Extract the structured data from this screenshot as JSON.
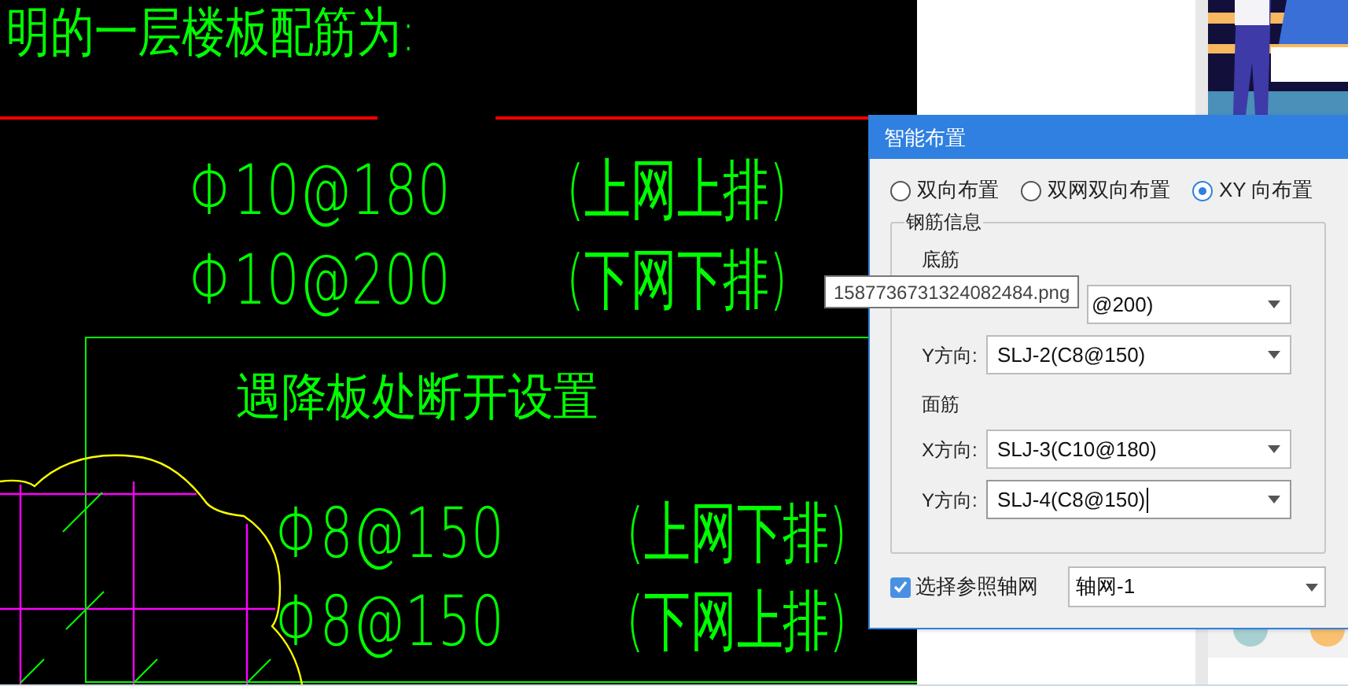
{
  "cad": {
    "heading": "明的一层楼板配筋为:",
    "top_rebar": [
      {
        "spec": "Φ10@180",
        "note": "(上网上排)"
      },
      {
        "spec": "Φ10@200",
        "note": "(下网下排)"
      }
    ],
    "note_title": "遇降板处断开设置",
    "bottom_rebar": [
      {
        "spec": "Φ8@150",
        "note": "(上网下排)"
      },
      {
        "spec": "Φ8@150",
        "note": "(下网上排)"
      }
    ]
  },
  "dialog": {
    "title": "智能布置",
    "modes": [
      {
        "label": "双向布置",
        "selected": false
      },
      {
        "label": "双网双向布置",
        "selected": false
      },
      {
        "label": "XY 向布置",
        "selected": true
      }
    ],
    "group": {
      "title": "钢筋信息",
      "sections": [
        {
          "title": "底筋",
          "rows": [
            {
              "value": "@200)",
              "focused": false
            },
            {
              "label": "Y方向:",
              "value": "SLJ-2(C8@150)",
              "focused": false
            }
          ]
        },
        {
          "title": "面筋",
          "rows": [
            {
              "label": "X方向:",
              "value": "SLJ-3(C10@180)",
              "focused": false
            },
            {
              "label": "Y方向:",
              "value": "SLJ-4(C8@150)",
              "focused": true
            }
          ]
        }
      ]
    },
    "axis_grid": {
      "label": "选择参照轴网",
      "checked": true,
      "value": "轴网-1"
    }
  },
  "tooltip": "1587736731324082484.png"
}
